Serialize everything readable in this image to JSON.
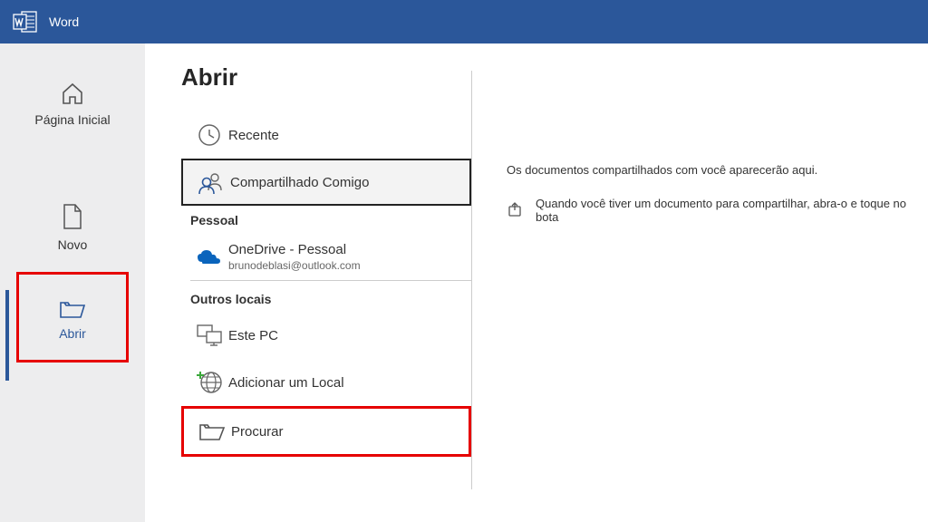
{
  "app": {
    "title": "Word"
  },
  "leftnav": {
    "home": "Página Inicial",
    "new": "Novo",
    "open": "Abrir"
  },
  "open": {
    "heading": "Abrir",
    "recent": "Recente",
    "shared": "Compartilhado Comigo",
    "personal_section": "Pessoal",
    "onedrive_label": "OneDrive - Pessoal",
    "onedrive_email": "brunodeblasi@outlook.com",
    "other_section": "Outros locais",
    "thispc": "Este PC",
    "addplace": "Adicionar um Local",
    "browse": "Procurar"
  },
  "rightpane": {
    "empty": "Os documentos compartilhados com você aparecerão aqui.",
    "share_hint": "Quando você tiver um documento para compartilhar, abra-o e toque no bota"
  }
}
